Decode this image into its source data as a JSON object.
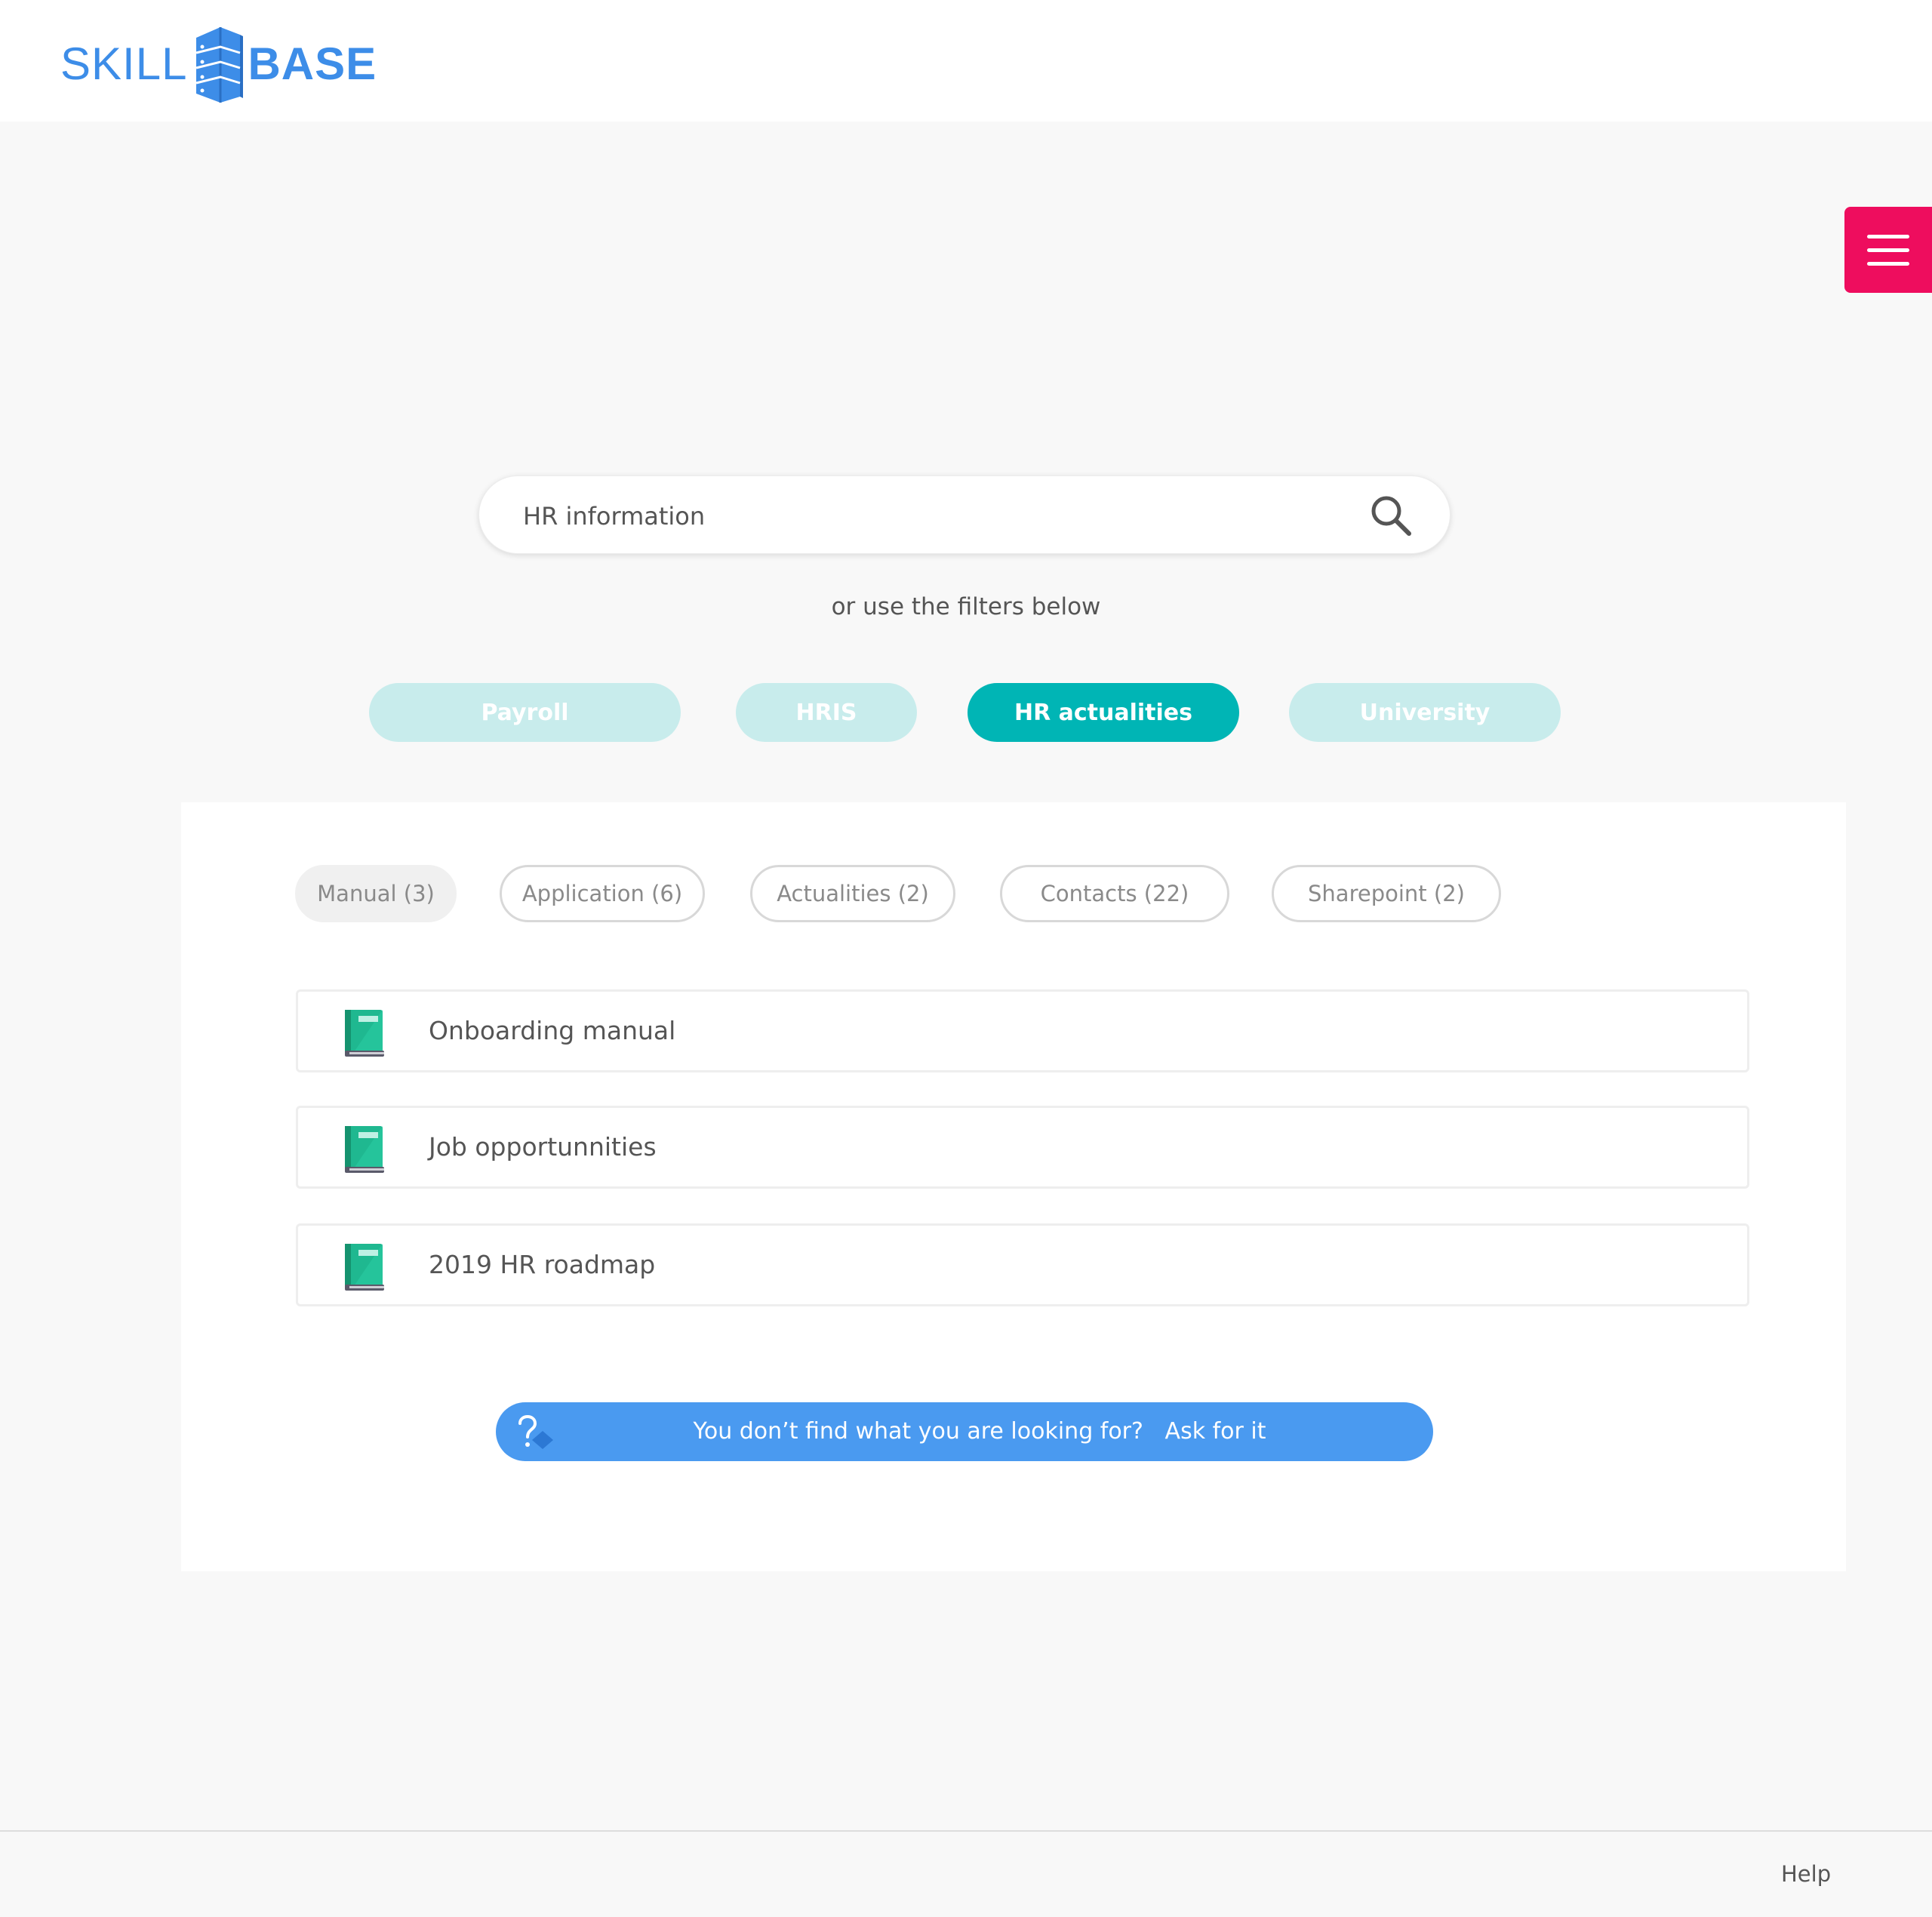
{
  "header": {
    "logo_left": "SKILL",
    "logo_right": "BASE"
  },
  "search": {
    "value": "HR information"
  },
  "filters_hint": "or use the filters below",
  "categories": [
    {
      "label": "Payroll",
      "active": false
    },
    {
      "label": "HRIS",
      "active": false
    },
    {
      "label": "HR actualities",
      "active": true
    },
    {
      "label": "University",
      "active": false
    }
  ],
  "tabs": [
    {
      "label": "Manual (3)",
      "selected": true
    },
    {
      "label": "Application (6)",
      "selected": false
    },
    {
      "label": "Actualities (2)",
      "selected": false
    },
    {
      "label": "Contacts (22)",
      "selected": false
    },
    {
      "label": "Sharepoint (2)",
      "selected": false
    }
  ],
  "results": [
    {
      "label": "Onboarding manual",
      "icon": "book-icon"
    },
    {
      "label": "Job opportunnities",
      "icon": "book-icon"
    },
    {
      "label": "2019 HR roadmap",
      "icon": "book-icon"
    }
  ],
  "ask": {
    "text": "You don’t find what you are looking for?   Ask for it"
  },
  "footer": {
    "help": "Help"
  },
  "colors": {
    "brand": "#3d8de8",
    "menu": "#ee0d5e",
    "active_pill": "#00b5b5",
    "inactive_pill": "#c8ecec",
    "ask_button": "#4a9af0"
  }
}
